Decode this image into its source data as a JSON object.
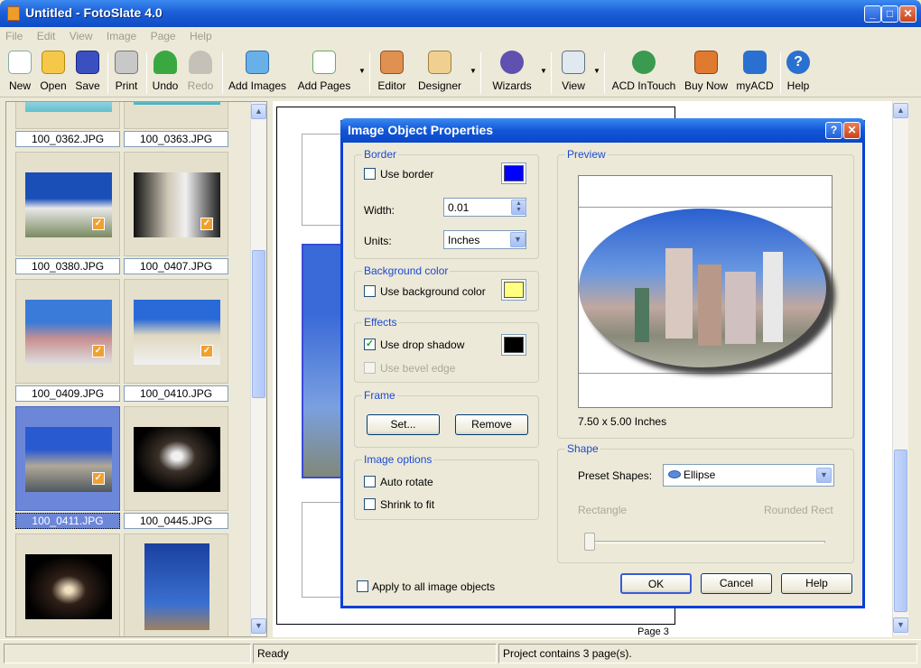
{
  "window": {
    "title": "Untitled - FotoSlate 4.0",
    "min": "_",
    "max": "□",
    "close": "✕"
  },
  "menu": [
    "File",
    "Edit",
    "View",
    "Image",
    "Page",
    "Help"
  ],
  "toolbar": {
    "new": "New",
    "open": "Open",
    "save": "Save",
    "print": "Print",
    "undo": "Undo",
    "redo": "Redo",
    "add_images": "Add Images",
    "add_pages": "Add Pages",
    "editor": "Editor",
    "designer": "Designer",
    "wizards": "Wizards",
    "view": "View",
    "acd_intouch": "ACD InTouch",
    "buy_now": "Buy Now",
    "myacd": "myACD",
    "help": "Help"
  },
  "thumbnails": [
    {
      "name": "100_0362.JPG",
      "checked": false,
      "selected": false
    },
    {
      "name": "100_0363.JPG",
      "checked": false,
      "selected": false
    },
    {
      "name": "100_0380.JPG",
      "checked": true,
      "selected": false
    },
    {
      "name": "100_0407.JPG",
      "checked": true,
      "selected": false
    },
    {
      "name": "100_0409.JPG",
      "checked": true,
      "selected": false
    },
    {
      "name": "100_0410.JPG",
      "checked": true,
      "selected": false
    },
    {
      "name": "100_0411.JPG",
      "checked": true,
      "selected": true
    },
    {
      "name": "100_0445.JPG",
      "checked": false,
      "selected": false
    },
    {
      "name": "",
      "checked": false,
      "selected": false
    },
    {
      "name": "",
      "checked": false,
      "selected": false
    }
  ],
  "canvas": {
    "page_label": "Page 3"
  },
  "dialog": {
    "title": "Image Object Properties",
    "help_btn": "?",
    "close_btn": "✕",
    "border": {
      "group": "Border",
      "use_border": "Use border",
      "use_border_checked": false,
      "color": "#0000ff",
      "width_label": "Width:",
      "width_value": "0.01",
      "units_label": "Units:",
      "units_value": "Inches"
    },
    "background": {
      "group": "Background color",
      "use_bg": "Use background color",
      "use_bg_checked": false,
      "color": "#ffff80"
    },
    "effects": {
      "group": "Effects",
      "drop_shadow": "Use drop shadow",
      "drop_shadow_checked": true,
      "shadow_color": "#000000",
      "bevel": "Use bevel edge",
      "bevel_checked": false
    },
    "frame": {
      "group": "Frame",
      "set": "Set...",
      "remove": "Remove"
    },
    "image_options": {
      "group": "Image options",
      "auto_rotate": "Auto rotate",
      "shrink": "Shrink to fit"
    },
    "apply_all": "Apply to all image objects",
    "preview": {
      "group": "Preview",
      "size": "7.50 x 5.00 Inches"
    },
    "shape": {
      "group": "Shape",
      "preset_label": "Preset Shapes:",
      "preset_value": "Ellipse",
      "slider_left": "Rectangle",
      "slider_right": "Rounded Rect",
      "slider_value": 0
    },
    "ok": "OK",
    "cancel": "Cancel",
    "help": "Help"
  },
  "status": {
    "left": "",
    "ready": "Ready",
    "project": "Project contains 3 page(s)."
  },
  "colors": {
    "accent": "#0a3fd8",
    "selection": "#6d87d8",
    "check_badge": "#f0a030"
  }
}
